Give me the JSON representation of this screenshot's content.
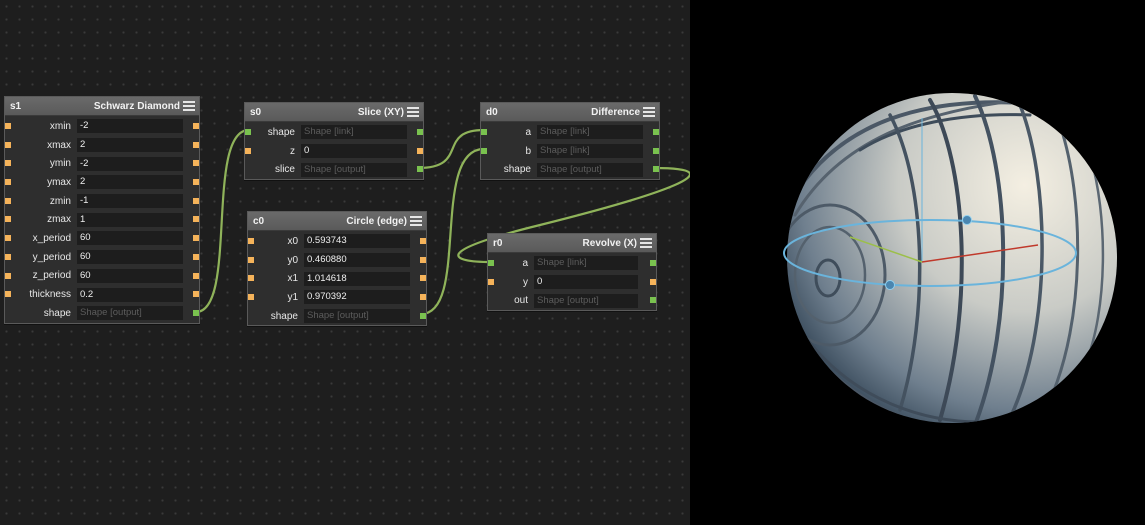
{
  "nodes": {
    "s1": {
      "name": "s1",
      "title": "Schwarz Diamond",
      "rows": [
        {
          "label": "xmin",
          "value": "-2"
        },
        {
          "label": "xmax",
          "value": "2"
        },
        {
          "label": "ymin",
          "value": "-2"
        },
        {
          "label": "ymax",
          "value": "2"
        },
        {
          "label": "zmin",
          "value": "-1"
        },
        {
          "label": "zmax",
          "value": "1"
        },
        {
          "label": "x_period",
          "value": "60"
        },
        {
          "label": "y_period",
          "value": "60"
        },
        {
          "label": "z_period",
          "value": "60"
        },
        {
          "label": "thickness",
          "value": "0.2"
        },
        {
          "label": "shape",
          "value": "Shape [output]"
        }
      ]
    },
    "s0": {
      "name": "s0",
      "title": "Slice (XY)",
      "rows": [
        {
          "label": "shape",
          "value": "Shape [link]"
        },
        {
          "label": "z",
          "value": "0"
        },
        {
          "label": "slice",
          "value": "Shape [output]"
        }
      ]
    },
    "c0": {
      "name": "c0",
      "title": "Circle (edge)",
      "rows": [
        {
          "label": "x0",
          "value": "0.593743"
        },
        {
          "label": "y0",
          "value": "0.460880"
        },
        {
          "label": "x1",
          "value": "1.014618"
        },
        {
          "label": "y1",
          "value": "0.970392"
        },
        {
          "label": "shape",
          "value": "Shape [output]"
        }
      ]
    },
    "d0": {
      "name": "d0",
      "title": "Difference",
      "rows": [
        {
          "label": "a",
          "value": "Shape [link]"
        },
        {
          "label": "b",
          "value": "Shape [link]"
        },
        {
          "label": "shape",
          "value": "Shape [output]"
        }
      ]
    },
    "r0": {
      "name": "r0",
      "title": "Revolve (X)",
      "rows": [
        {
          "label": "a",
          "value": "Shape [link]"
        },
        {
          "label": "y",
          "value": "0"
        },
        {
          "label": "out",
          "value": "Shape [output]"
        }
      ]
    }
  },
  "colors": {
    "wire": "#8fb35a",
    "shape_port": "#7ac24f",
    "value_port": "#f5b35a",
    "ring": "#6ab4dc"
  }
}
